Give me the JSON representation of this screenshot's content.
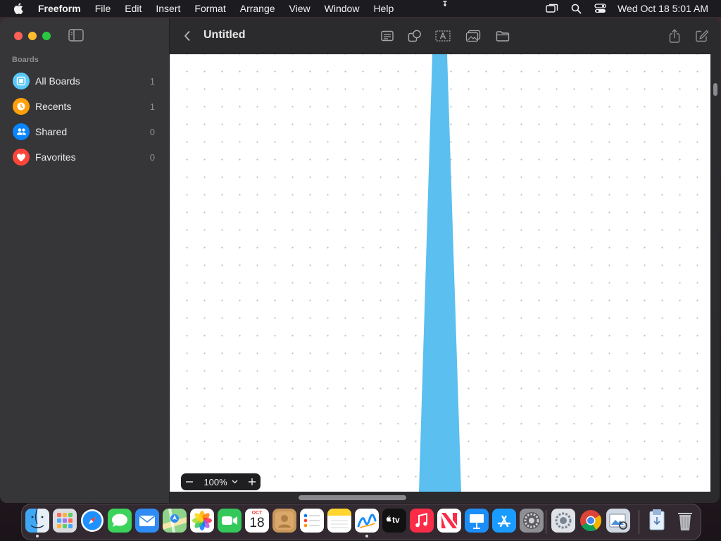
{
  "menubar": {
    "app_name": "Freeform",
    "items": [
      "File",
      "Edit",
      "Insert",
      "Format",
      "Arrange",
      "View",
      "Window",
      "Help"
    ],
    "clock": "Wed Oct 18  5:01 AM"
  },
  "sidebar": {
    "section_title": "Boards",
    "items": [
      {
        "label": "All Boards",
        "count": "1",
        "icon": "boards-icon",
        "color": "#5ac8fa"
      },
      {
        "label": "Recents",
        "count": "1",
        "icon": "clock-icon",
        "color": "#ff9f0a"
      },
      {
        "label": "Shared",
        "count": "0",
        "icon": "people-icon",
        "color": "#0a84ff"
      },
      {
        "label": "Favorites",
        "count": "0",
        "icon": "heart-icon",
        "color": "#ff453a"
      }
    ]
  },
  "toolbar": {
    "title": "Untitled",
    "tools": [
      "sticky-note-icon",
      "shapes-icon",
      "text-box-icon",
      "media-icon",
      "folder-icon"
    ],
    "right": [
      "share-icon",
      "edit-icon"
    ]
  },
  "canvas": {
    "stroke_color": "#5bbff0"
  },
  "zoom": {
    "value": "100%"
  },
  "dock": {
    "apps": [
      "Finder",
      "Launchpad",
      "Safari",
      "Messages",
      "Mail",
      "Maps",
      "Photos",
      "FaceTime",
      "Calendar",
      "Contacts",
      "Reminders",
      "Notes",
      "Freeform",
      "TV",
      "Music",
      "News",
      "Keynote",
      "App Store",
      "System Settings",
      "Utility",
      "Chrome",
      "Preview",
      "Downloads",
      "Trash"
    ],
    "calendar_month": "OCT",
    "calendar_day": "18",
    "tv_label": "tv"
  }
}
